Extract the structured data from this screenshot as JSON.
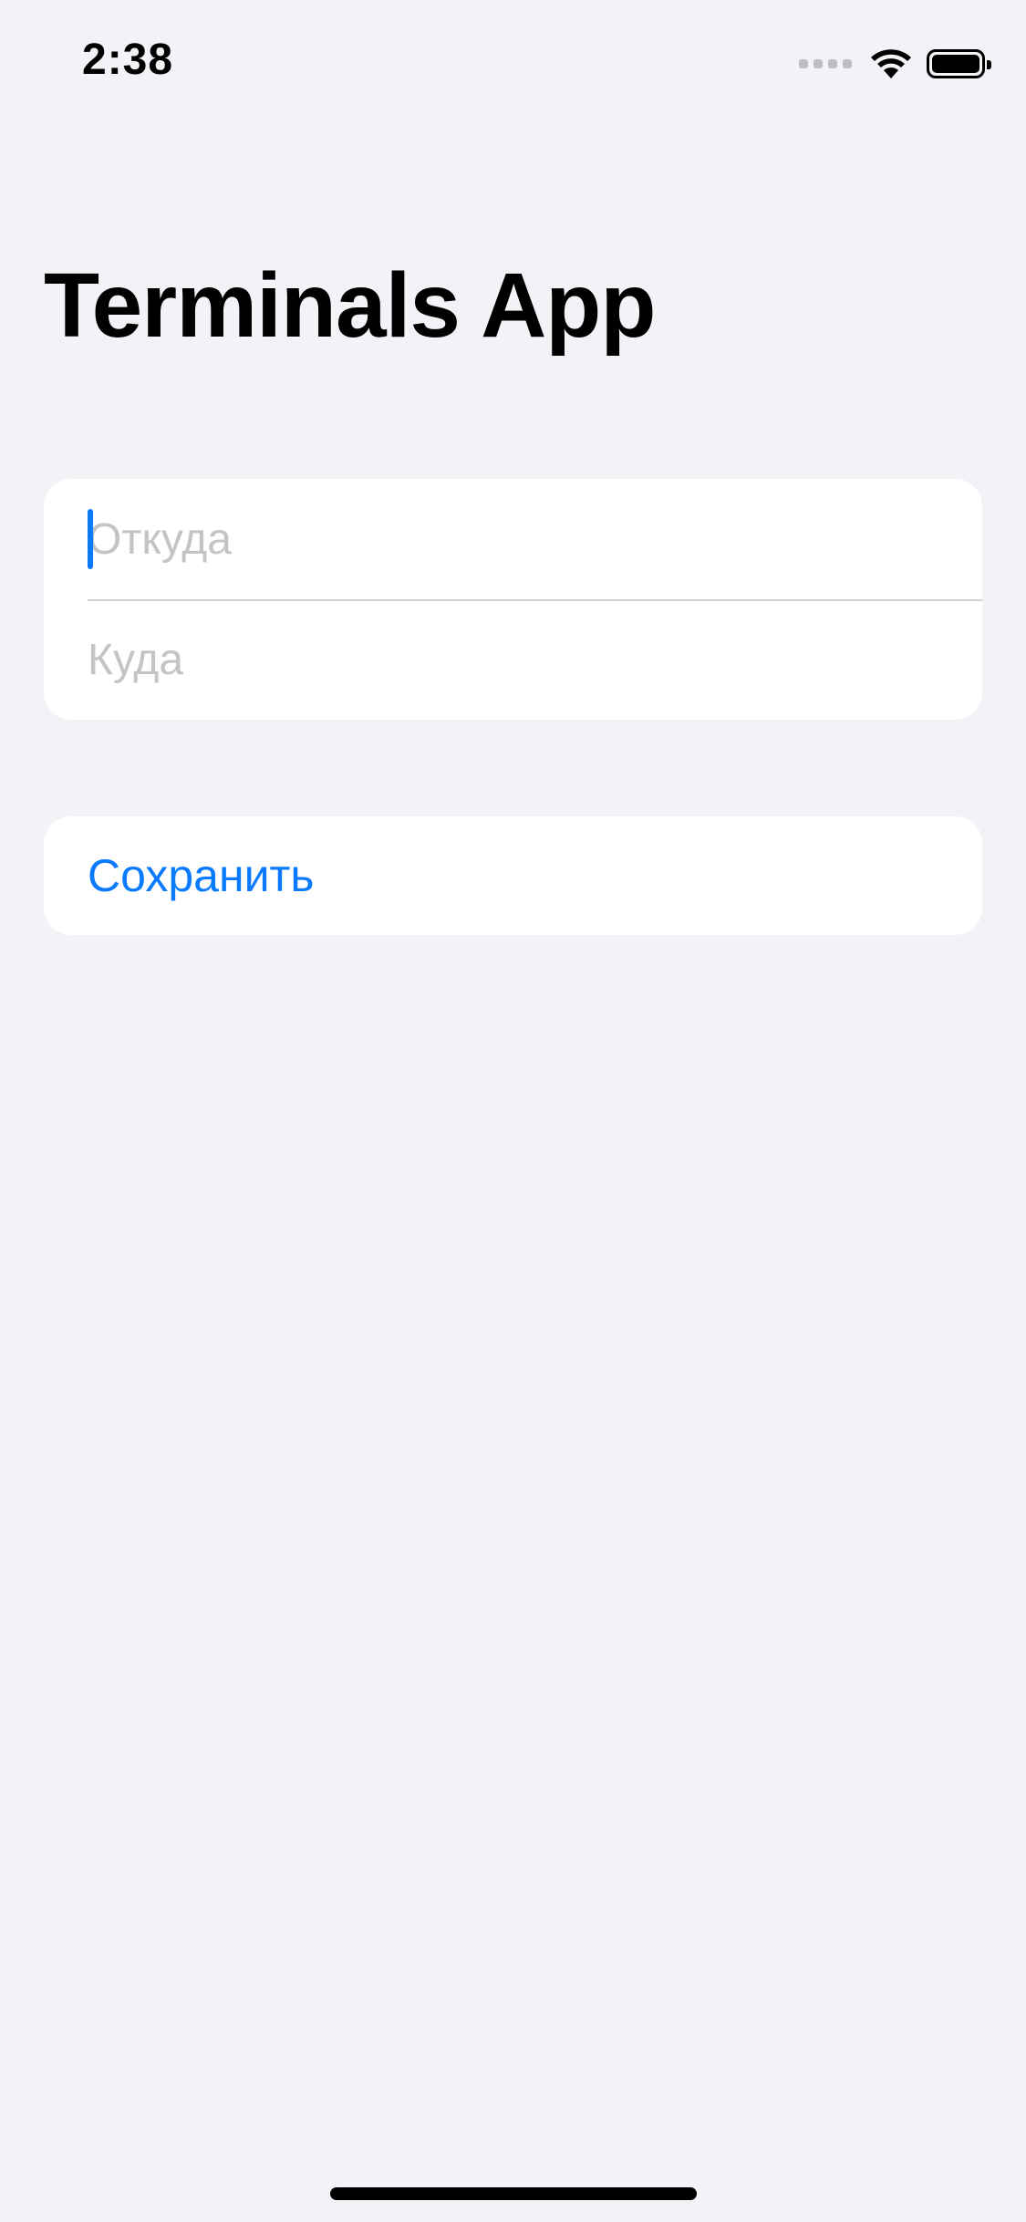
{
  "status_bar": {
    "time": "2:38",
    "icons": [
      "signal-icon",
      "wifi-icon",
      "battery-icon"
    ]
  },
  "header": {
    "title": "Terminals App"
  },
  "form": {
    "from_placeholder": "Откуда",
    "from_value": "",
    "to_placeholder": "Куда",
    "to_value": ""
  },
  "actions": {
    "save_label": "Сохранить"
  },
  "colors": {
    "background": "#f2f2f7",
    "card": "#ffffff",
    "accent": "#0a7aff",
    "placeholder": "#c4c4c7",
    "separator": "#d1d1d6"
  }
}
